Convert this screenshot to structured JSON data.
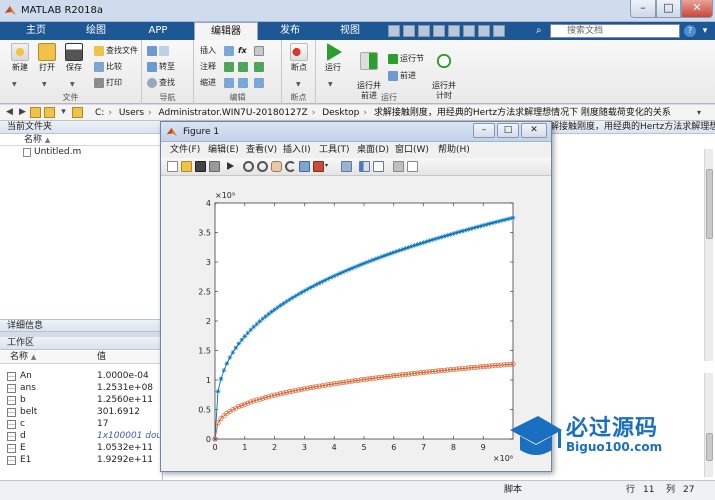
{
  "window": {
    "title": "MATLAB R2018a",
    "min": "–",
    "max": "□",
    "close": "✕"
  },
  "tabs": [
    {
      "label": "主页",
      "active": false
    },
    {
      "label": "绘图",
      "active": false
    },
    {
      "label": "APP",
      "active": false
    },
    {
      "label": "编辑器",
      "active": true
    },
    {
      "label": "发布",
      "active": false
    },
    {
      "label": "视图",
      "active": false
    }
  ],
  "search": {
    "placeholder": "搜索文档"
  },
  "ribbon": {
    "file_group": {
      "label": "文件",
      "new": "新建",
      "open": "打开",
      "save": "保存",
      "find_files": "查找文件",
      "compare": "比较",
      "print": "打印"
    },
    "nav_group": {
      "label": "导航",
      "goto": "转至",
      "find": "查找"
    },
    "edit_group": {
      "label": "编辑",
      "insert": "插入",
      "comment": "注释",
      "indent": "缩进",
      "fx": "fx"
    },
    "breakpoint_group": {
      "label": "断点",
      "breakpoints": "断点"
    },
    "run_group": {
      "label": "运行",
      "run": "运行",
      "run_advance": "运行并\n前进",
      "run_section": "运行节",
      "advance": "前进",
      "run_time": "运行并\n计时"
    }
  },
  "address": {
    "segments": [
      "C:",
      "Users",
      "Administrator.WIN7U-20180127Z",
      "Desktop",
      "求解接触刚度，用经典的Hertz方法求解理想情况下 刚度随载荷变化的关系"
    ],
    "dropdown": "▾"
  },
  "current_folder": {
    "header": "当前文件夹",
    "col_name": "名称",
    "sort": "▲",
    "files": [
      {
        "name": "Untitled.m"
      }
    ]
  },
  "detail_panel": {
    "header": "详细信息"
  },
  "workspace": {
    "header": "工作区",
    "col_name": "名称",
    "col_name_sort": "▲",
    "col_value": "值",
    "rows": [
      {
        "name": "An",
        "value": "1.0000e-04",
        "italic": false
      },
      {
        "name": "ans",
        "value": "1.2531e+08",
        "italic": false
      },
      {
        "name": "b",
        "value": "1.2560e+11",
        "italic": false
      },
      {
        "name": "belt",
        "value": "301.6912",
        "italic": false
      },
      {
        "name": "c",
        "value": "17",
        "italic": false
      },
      {
        "name": "d",
        "value": "1x100001 doub",
        "italic": true
      },
      {
        "name": "E",
        "value": "1.0532e+11",
        "italic": false
      },
      {
        "name": "E1",
        "value": "1.9292e+11",
        "italic": false
      }
    ]
  },
  "right_header": "解接触刚度，用经典的Hertz方法求解理想情况下 刚度随载荷变化的关",
  "statusbar": {
    "mode": "脚本",
    "row_label": "行",
    "row": "11",
    "col_label": "列",
    "col": "27"
  },
  "figure": {
    "title": "Figure 1",
    "menus": [
      "文件(F)",
      "编辑(E)",
      "查看(V)",
      "插入(I)",
      "工具(T)",
      "桌面(D)",
      "窗口(W)",
      "帮助(H)"
    ]
  },
  "chart_data": {
    "type": "line",
    "title": "",
    "xlabel": "",
    "ylabel": "",
    "x_exponent_label": "×10⁸",
    "y_exponent_label": "×10⁹",
    "xlim": [
      0,
      10
    ],
    "ylim": [
      0,
      4
    ],
    "xticks": [
      0,
      1,
      2,
      3,
      4,
      5,
      6,
      7,
      8,
      9
    ],
    "yticks": [
      0,
      0.5,
      1,
      1.5,
      2,
      2.5,
      3,
      3.5,
      4
    ],
    "grid": false,
    "series": [
      {
        "marker": "asterisk",
        "color": "#0072BD",
        "y_at_x10": 3.75,
        "curve": "power-1/3"
      },
      {
        "marker": "circle",
        "color": "#D95319",
        "y_at_x10": 1.27,
        "curve": "power-1/3"
      }
    ]
  },
  "watermark": {
    "cn": "必过源码",
    "en": "Biguo100.com"
  },
  "colors": {
    "tab_blue": "#1d5794",
    "series1": "#0072BD",
    "series2": "#D95319",
    "watermark": "#1a6fc0"
  }
}
